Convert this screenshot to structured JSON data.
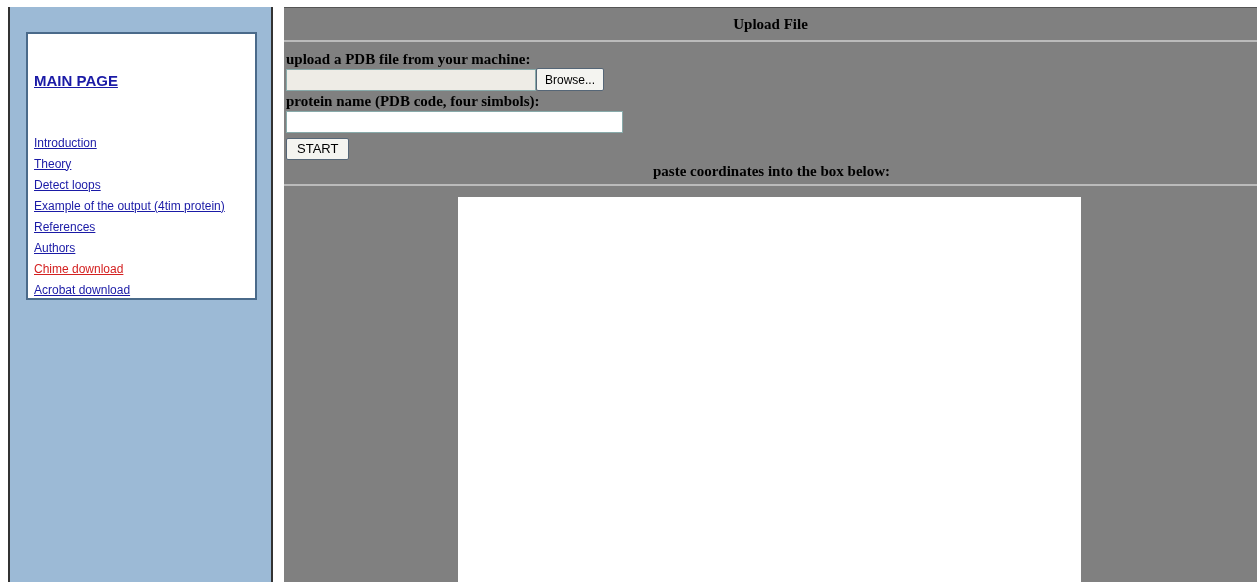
{
  "sidebar": {
    "main_link": "MAIN PAGE",
    "links": [
      {
        "label": "Introduction",
        "color": "#1a1aa6"
      },
      {
        "label": "Theory",
        "color": "#1a1aa6"
      },
      {
        "label": "Detect loops",
        "color": "#1a1aa6"
      },
      {
        "label": "Example of the output (4tim protein)",
        "color": "#1a1aa6"
      },
      {
        "label": "References",
        "color": "#1a1aa6"
      },
      {
        "label": "Authors",
        "color": "#1a1aa6"
      },
      {
        "label": "Chime download",
        "color": "#d42020"
      },
      {
        "label": "Acrobat download",
        "color": "#1a1aa6"
      }
    ]
  },
  "main": {
    "title": "Upload File",
    "upload_label": "upload a PDB file from your machine:",
    "browse_button": "Browse...",
    "name_label": "protein name (PDB code, four simbols):",
    "start_button": "START",
    "paste_label": "paste coordinates into the box below:"
  }
}
